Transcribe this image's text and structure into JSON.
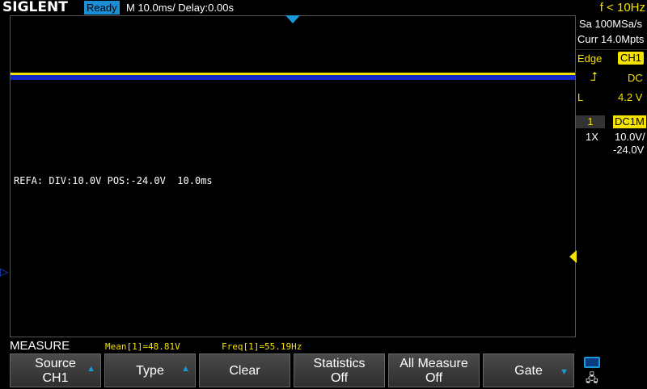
{
  "header": {
    "logo": "SIGLENT",
    "status": "Ready",
    "timebase": "M 10.0ms/ Delay:0.00s",
    "frequency": "f < 10Hz"
  },
  "screen": {
    "ref_info": "REFA: DIV:10.0V POS:-24.0V  10.0ms",
    "ref_marker_glyph": "▷",
    "colors": {
      "ch1": "#f4e200",
      "ref": "#1428c8",
      "accent": "#1a9ad8"
    }
  },
  "sidebar": {
    "sample_rate": "Sa 100MSa/s",
    "memory": "Curr 14.0Mpts",
    "trigger_type": "Edge",
    "trigger_source": "CH1",
    "slope_icon": "rising-edge-icon",
    "slope_glyph": "⮥",
    "coupling": "DC",
    "level_label": "L",
    "level_value": "4.2 V",
    "ch_number": "1",
    "ch_coupling": "DC1M",
    "probe": "1X",
    "volts_div": "10.0V/",
    "offset": "-24.0V"
  },
  "measure": {
    "title": "MEASURE",
    "mean": "Mean[1]=48.81V",
    "freq": "Freq[1]=55.19Hz"
  },
  "softkeys": [
    {
      "l1": "Source",
      "l2": "CH1"
    },
    {
      "label": "Type"
    },
    {
      "label": "Clear"
    },
    {
      "l1": "Statistics",
      "l2": "Off"
    },
    {
      "l1": "All Measure",
      "l2": "Off"
    },
    {
      "label": "Gate"
    }
  ],
  "glyphs": {
    "up": "▲",
    "down": "▼",
    "network": "🖧"
  }
}
